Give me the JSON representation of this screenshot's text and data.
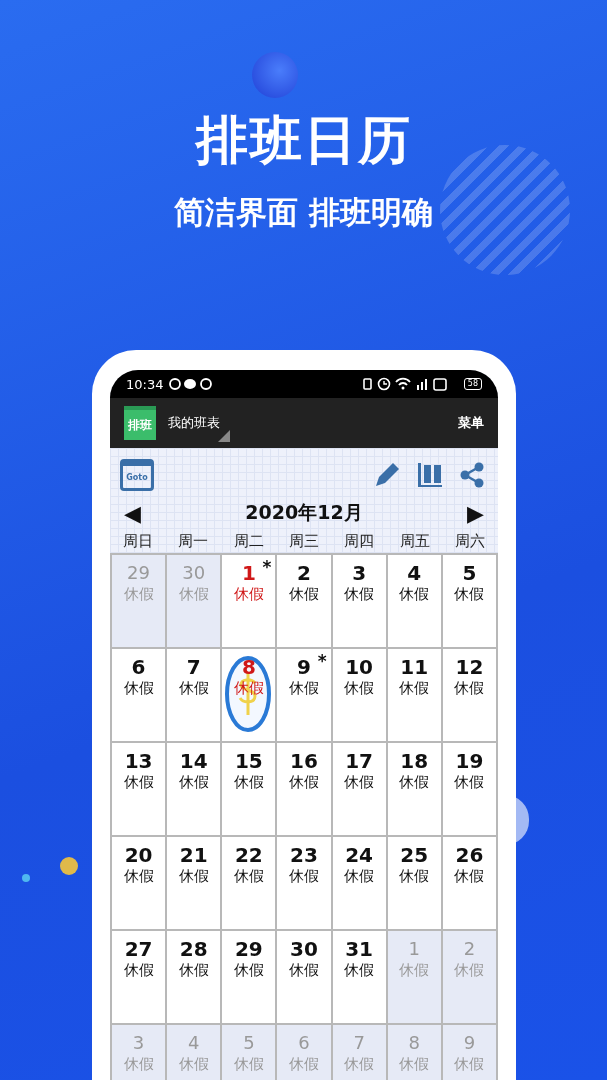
{
  "promo": {
    "title": "排班日历",
    "subtitle": "简洁界面 排班明确"
  },
  "status_bar": {
    "time": "10:34",
    "battery": "58"
  },
  "app_bar": {
    "icon_text": "排班",
    "title": "我的班表",
    "menu": "菜单"
  },
  "toolbar": {
    "goto": "Goto"
  },
  "calendar": {
    "month": "2020年12月",
    "prev": "◀",
    "next": "▶",
    "weekdays": [
      "周日",
      "周一",
      "周二",
      "周三",
      "周四",
      "周五",
      "周六"
    ],
    "weeks": [
      [
        {
          "day": "29",
          "label": "休假",
          "outside": true,
          "today": false
        },
        {
          "day": "30",
          "label": "休假",
          "outside": true,
          "today": false
        },
        {
          "day": "1",
          "label": "休假",
          "outside": false,
          "today": true,
          "mark": "*"
        },
        {
          "day": "2",
          "label": "休假",
          "outside": false,
          "today": false
        },
        {
          "day": "3",
          "label": "休假",
          "outside": false,
          "today": false
        },
        {
          "day": "4",
          "label": "休假",
          "outside": false,
          "today": false
        },
        {
          "day": "5",
          "label": "休假",
          "outside": false,
          "today": false
        }
      ],
      [
        {
          "day": "6",
          "label": "休假",
          "outside": false,
          "today": false
        },
        {
          "day": "7",
          "label": "休假",
          "outside": false,
          "today": false
        },
        {
          "day": "8",
          "label": "休假",
          "outside": false,
          "today": true,
          "sticker": true
        },
        {
          "day": "9",
          "label": "休假",
          "outside": false,
          "today": false,
          "mark": "*"
        },
        {
          "day": "10",
          "label": "休假",
          "outside": false,
          "today": false
        },
        {
          "day": "11",
          "label": "休假",
          "outside": false,
          "today": false
        },
        {
          "day": "12",
          "label": "休假",
          "outside": false,
          "today": false
        }
      ],
      [
        {
          "day": "13",
          "label": "休假",
          "outside": false,
          "today": false
        },
        {
          "day": "14",
          "label": "休假",
          "outside": false,
          "today": false
        },
        {
          "day": "15",
          "label": "休假",
          "outside": false,
          "today": false
        },
        {
          "day": "16",
          "label": "休假",
          "outside": false,
          "today": false
        },
        {
          "day": "17",
          "label": "休假",
          "outside": false,
          "today": false
        },
        {
          "day": "18",
          "label": "休假",
          "outside": false,
          "today": false
        },
        {
          "day": "19",
          "label": "休假",
          "outside": false,
          "today": false
        }
      ],
      [
        {
          "day": "20",
          "label": "休假",
          "outside": false,
          "today": false
        },
        {
          "day": "21",
          "label": "休假",
          "outside": false,
          "today": false
        },
        {
          "day": "22",
          "label": "休假",
          "outside": false,
          "today": false
        },
        {
          "day": "23",
          "label": "休假",
          "outside": false,
          "today": false
        },
        {
          "day": "24",
          "label": "休假",
          "outside": false,
          "today": false
        },
        {
          "day": "25",
          "label": "休假",
          "outside": false,
          "today": false
        },
        {
          "day": "26",
          "label": "休假",
          "outside": false,
          "today": false
        }
      ],
      [
        {
          "day": "27",
          "label": "休假",
          "outside": false,
          "today": false
        },
        {
          "day": "28",
          "label": "休假",
          "outside": false,
          "today": false
        },
        {
          "day": "29",
          "label": "休假",
          "outside": false,
          "today": false
        },
        {
          "day": "30",
          "label": "休假",
          "outside": false,
          "today": false
        },
        {
          "day": "31",
          "label": "休假",
          "outside": false,
          "today": false
        },
        {
          "day": "1",
          "label": "休假",
          "outside": true,
          "today": false
        },
        {
          "day": "2",
          "label": "休假",
          "outside": true,
          "today": false
        }
      ],
      [
        {
          "day": "3",
          "label": "休假",
          "outside": true,
          "today": false
        },
        {
          "day": "4",
          "label": "休假",
          "outside": true,
          "today": false
        },
        {
          "day": "5",
          "label": "休假",
          "outside": true,
          "today": false
        },
        {
          "day": "6",
          "label": "休假",
          "outside": true,
          "today": false
        },
        {
          "day": "7",
          "label": "休假",
          "outside": true,
          "today": false
        },
        {
          "day": "8",
          "label": "休假",
          "outside": true,
          "today": false
        },
        {
          "day": "9",
          "label": "休假",
          "outside": true,
          "today": false
        }
      ]
    ]
  }
}
